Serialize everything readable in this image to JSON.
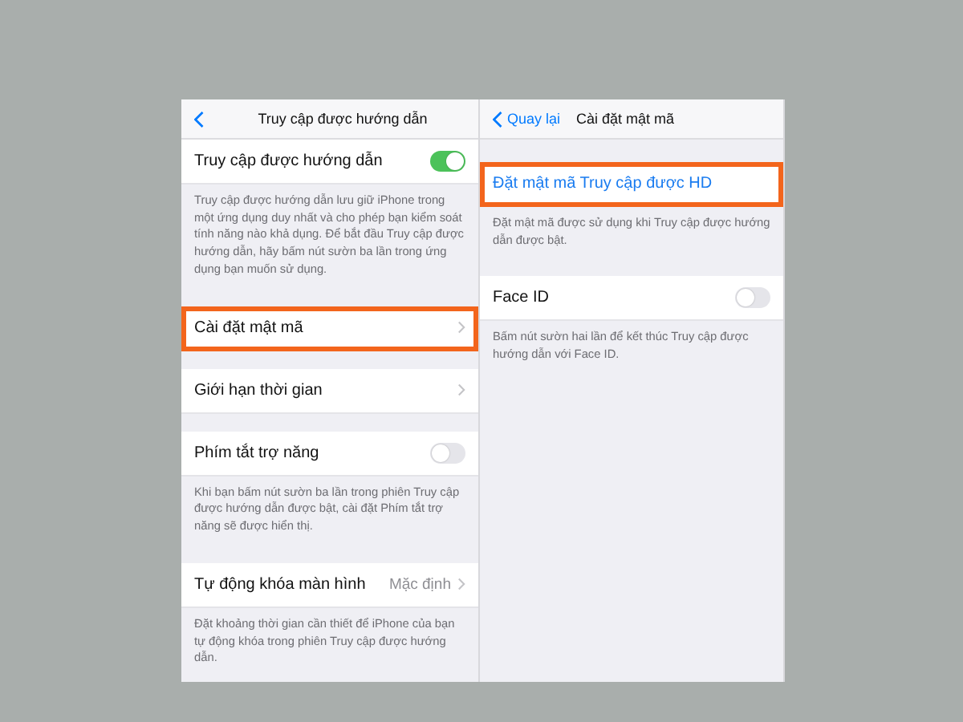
{
  "panels": [
    {
      "title": "Truy cập được hướng dẫn",
      "sections": [
        {
          "rows": [
            {
              "kind": "toggle",
              "label": "Truy cập được hướng dẫn",
              "on": true,
              "highlighted": false
            }
          ],
          "footer": "Truy cập được hướng dẫn lưu giữ iPhone trong một ứng dụng duy nhất và cho phép bạn kiểm soát tính năng nào khả dụng. Để bắt đầu Truy cập được hướng dẫn, hãy bấm nút sườn ba lần trong ứng dụng bạn muốn sử dụng."
        },
        {
          "rows": [
            {
              "kind": "link",
              "label": "Cài đặt mật mã",
              "highlighted": true
            }
          ]
        },
        {
          "rows": [
            {
              "kind": "link",
              "label": "Giới hạn thời gian",
              "highlighted": false
            }
          ]
        },
        {
          "rows": [
            {
              "kind": "toggle",
              "label": "Phím tắt trợ năng",
              "on": false,
              "highlighted": false
            }
          ],
          "footer": "Khi bạn bấm nút sườn ba lần trong phiên Truy cập được hướng dẫn được bật, cài đặt Phím tắt trợ năng sẽ được hiển thị."
        },
        {
          "rows": [
            {
              "kind": "value",
              "label": "Tự động khóa màn hình",
              "value": "Mặc định",
              "highlighted": false
            }
          ],
          "footer": "Đặt khoảng thời gian cần thiết để iPhone của bạn tự động khóa trong phiên Truy cập được hướng dẫn."
        }
      ]
    },
    {
      "back": "Quay lại",
      "title": "Cài đặt mật mã",
      "sections": [
        {
          "rows": [
            {
              "kind": "action",
              "label": "Đặt mật mã Truy cập được HD",
              "highlighted": true
            }
          ],
          "footer": "Đặt mật mã được sử dụng khi Truy cập được hướng dẫn được bật."
        },
        {
          "rows": [
            {
              "kind": "toggle",
              "label": "Face ID",
              "on": false,
              "highlighted": false
            }
          ],
          "footer": "Bấm nút sườn hai lần để kết thúc Truy cập được hướng dẫn với Face ID."
        }
      ]
    }
  ]
}
